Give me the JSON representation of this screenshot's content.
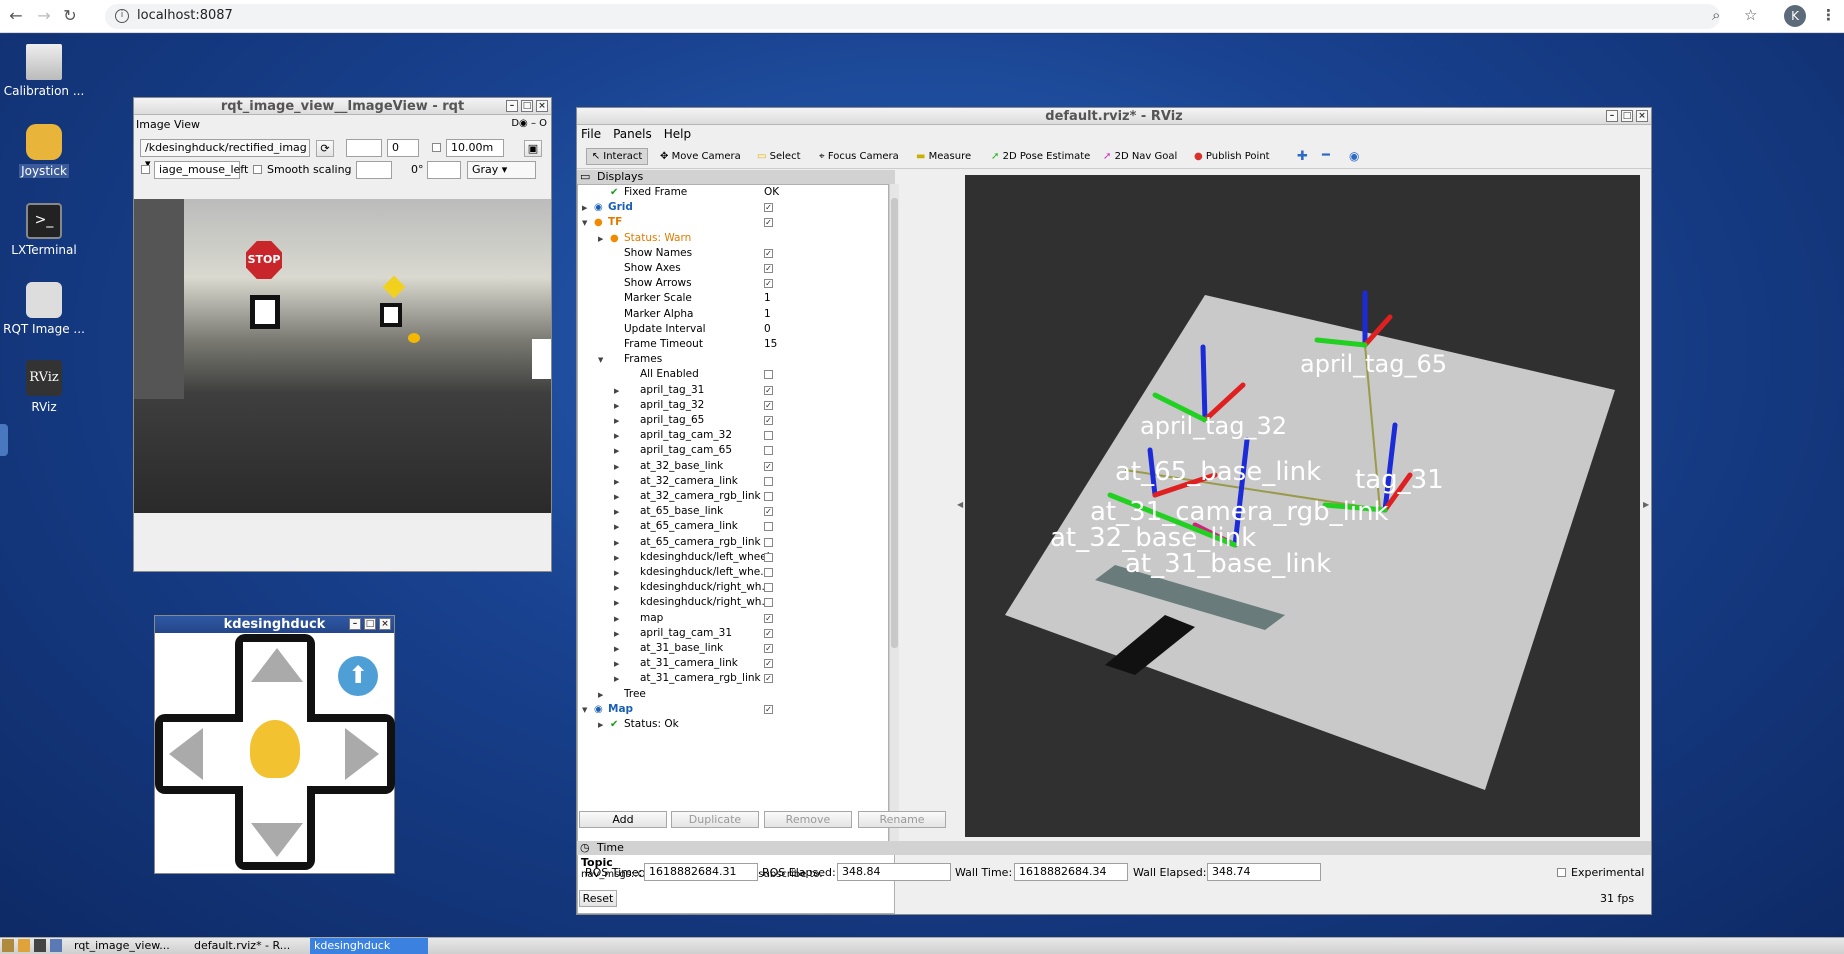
{
  "browser": {
    "url": "localhost:8087",
    "avatar_letter": "K"
  },
  "desktop_icons": [
    {
      "label": "Calibration ...",
      "icon": "calibration-icon"
    },
    {
      "label": "Joystick",
      "icon": "joystick-icon"
    },
    {
      "label": "LXTerminal",
      "icon": "terminal-icon"
    },
    {
      "label": "RQT Image ...",
      "icon": "camera-icon"
    },
    {
      "label": "RViz",
      "icon": "rviz-icon"
    }
  ],
  "rqt": {
    "title": "rqt_image_view__ImageView - rqt",
    "plugin": "Image View",
    "topic": "/kdesinghduck/rectified_imag",
    "spin_value": "0",
    "max_range": "10.00m",
    "mouse_topic": "iage_mouse_left",
    "smooth": "Smooth scaling",
    "rotation": "0°",
    "color": "Gray",
    "sign_stop": "STOP"
  },
  "joystick": {
    "title": "kdesinghduck"
  },
  "rviz": {
    "title": "default.rviz* - RViz",
    "menu": [
      "File",
      "Panels",
      "Help"
    ],
    "tools": [
      "Interact",
      "Move Camera",
      "Select",
      "Focus Camera",
      "Measure",
      "2D Pose Estimate",
      "2D Nav Goal",
      "Publish Point"
    ],
    "displays_title": "Displays",
    "tree": [
      {
        "label": "Fixed Frame",
        "value": "OK",
        "indent": 2,
        "check": false,
        "ok": true
      },
      {
        "label": "Grid",
        "indent": 1,
        "check": true,
        "checked": true,
        "blue": true,
        "expand": true
      },
      {
        "label": "TF",
        "indent": 1,
        "check": true,
        "checked": true,
        "warn": true,
        "expand": true,
        "open": true
      },
      {
        "label": "Status: Warn",
        "indent": 2,
        "warnlbl": true,
        "expand": true
      },
      {
        "label": "Show Names",
        "indent": 2,
        "check": true,
        "checked": true
      },
      {
        "label": "Show Axes",
        "indent": 2,
        "check": true,
        "checked": true
      },
      {
        "label": "Show Arrows",
        "indent": 2,
        "check": true,
        "checked": true
      },
      {
        "label": "Marker Scale",
        "value": "1",
        "indent": 2
      },
      {
        "label": "Marker Alpha",
        "value": "1",
        "indent": 2
      },
      {
        "label": "Update Interval",
        "value": "0",
        "indent": 2
      },
      {
        "label": "Frame Timeout",
        "value": "15",
        "indent": 2
      },
      {
        "label": "Frames",
        "indent": 2,
        "expand": true,
        "open": true
      },
      {
        "label": "All Enabled",
        "indent": 3,
        "check": true,
        "checked": false
      },
      {
        "label": "april_tag_31",
        "indent": 3,
        "check": true,
        "checked": true,
        "expand": true
      },
      {
        "label": "april_tag_32",
        "indent": 3,
        "check": true,
        "checked": true,
        "expand": true
      },
      {
        "label": "april_tag_65",
        "indent": 3,
        "check": true,
        "checked": true,
        "expand": true
      },
      {
        "label": "april_tag_cam_32",
        "indent": 3,
        "check": true,
        "checked": false,
        "expand": true
      },
      {
        "label": "april_tag_cam_65",
        "indent": 3,
        "check": true,
        "checked": false,
        "expand": true
      },
      {
        "label": "at_32_base_link",
        "indent": 3,
        "check": true,
        "checked": true,
        "expand": true
      },
      {
        "label": "at_32_camera_link",
        "indent": 3,
        "check": true,
        "checked": false,
        "expand": true
      },
      {
        "label": "at_32_camera_rgb_link",
        "indent": 3,
        "check": true,
        "checked": false,
        "expand": true
      },
      {
        "label": "at_65_base_link",
        "indent": 3,
        "check": true,
        "checked": true,
        "expand": true
      },
      {
        "label": "at_65_camera_link",
        "indent": 3,
        "check": true,
        "checked": false,
        "expand": true
      },
      {
        "label": "at_65_camera_rgb_link",
        "indent": 3,
        "check": true,
        "checked": false,
        "expand": true
      },
      {
        "label": "kdesinghduck/left_wheel",
        "indent": 3,
        "check": true,
        "checked": false,
        "expand": true
      },
      {
        "label": "kdesinghduck/left_whe...",
        "indent": 3,
        "check": true,
        "checked": false,
        "expand": true
      },
      {
        "label": "kdesinghduck/right_wh...",
        "indent": 3,
        "check": true,
        "checked": false,
        "expand": true
      },
      {
        "label": "kdesinghduck/right_wh...",
        "indent": 3,
        "check": true,
        "checked": false,
        "expand": true
      },
      {
        "label": "map",
        "indent": 3,
        "check": true,
        "checked": true,
        "expand": true
      },
      {
        "label": "april_tag_cam_31",
        "indent": 3,
        "check": true,
        "checked": true,
        "expand": true
      },
      {
        "label": "at_31_base_link",
        "indent": 3,
        "check": true,
        "checked": true,
        "expand": true
      },
      {
        "label": "at_31_camera_link",
        "indent": 3,
        "check": true,
        "checked": true,
        "expand": true
      },
      {
        "label": "at_31_camera_rgb_link",
        "indent": 3,
        "check": true,
        "checked": true,
        "expand": true
      },
      {
        "label": "Tree",
        "indent": 2,
        "expand": true
      },
      {
        "label": "Map",
        "indent": 1,
        "check": true,
        "checked": true,
        "blue": true,
        "expand": true,
        "open": true
      },
      {
        "label": "Status: Ok",
        "indent": 2,
        "ok": true,
        "expand": true
      }
    ],
    "topic_title": "Topic",
    "topic_desc": "nav_msgs::OccupancyGrid topic to subscribe to.",
    "buttons": [
      "Add",
      "Duplicate",
      "Remove",
      "Rename"
    ],
    "scene_labels": [
      "april_tag_65",
      "april_tag_32",
      "at_65_base_link",
      "at_31_camera_rgb_link",
      "tag_31",
      "at_32_base_link",
      "at_31_base_link"
    ],
    "time": {
      "title": "Time",
      "ros_time_label": "ROS Time:",
      "ros_time": "1618882684.31",
      "ros_elapsed_label": "ROS Elapsed:",
      "ros_elapsed": "348.84",
      "wall_time_label": "Wall Time:",
      "wall_time": "1618882684.34",
      "wall_elapsed_label": "Wall Elapsed:",
      "wall_elapsed": "348.74",
      "experimental": "Experimental",
      "reset": "Reset",
      "fps": "31 fps"
    }
  },
  "taskbar": {
    "items": [
      "rqt_image_view...",
      "default.rviz* - R...",
      "kdesinghduck"
    ]
  }
}
